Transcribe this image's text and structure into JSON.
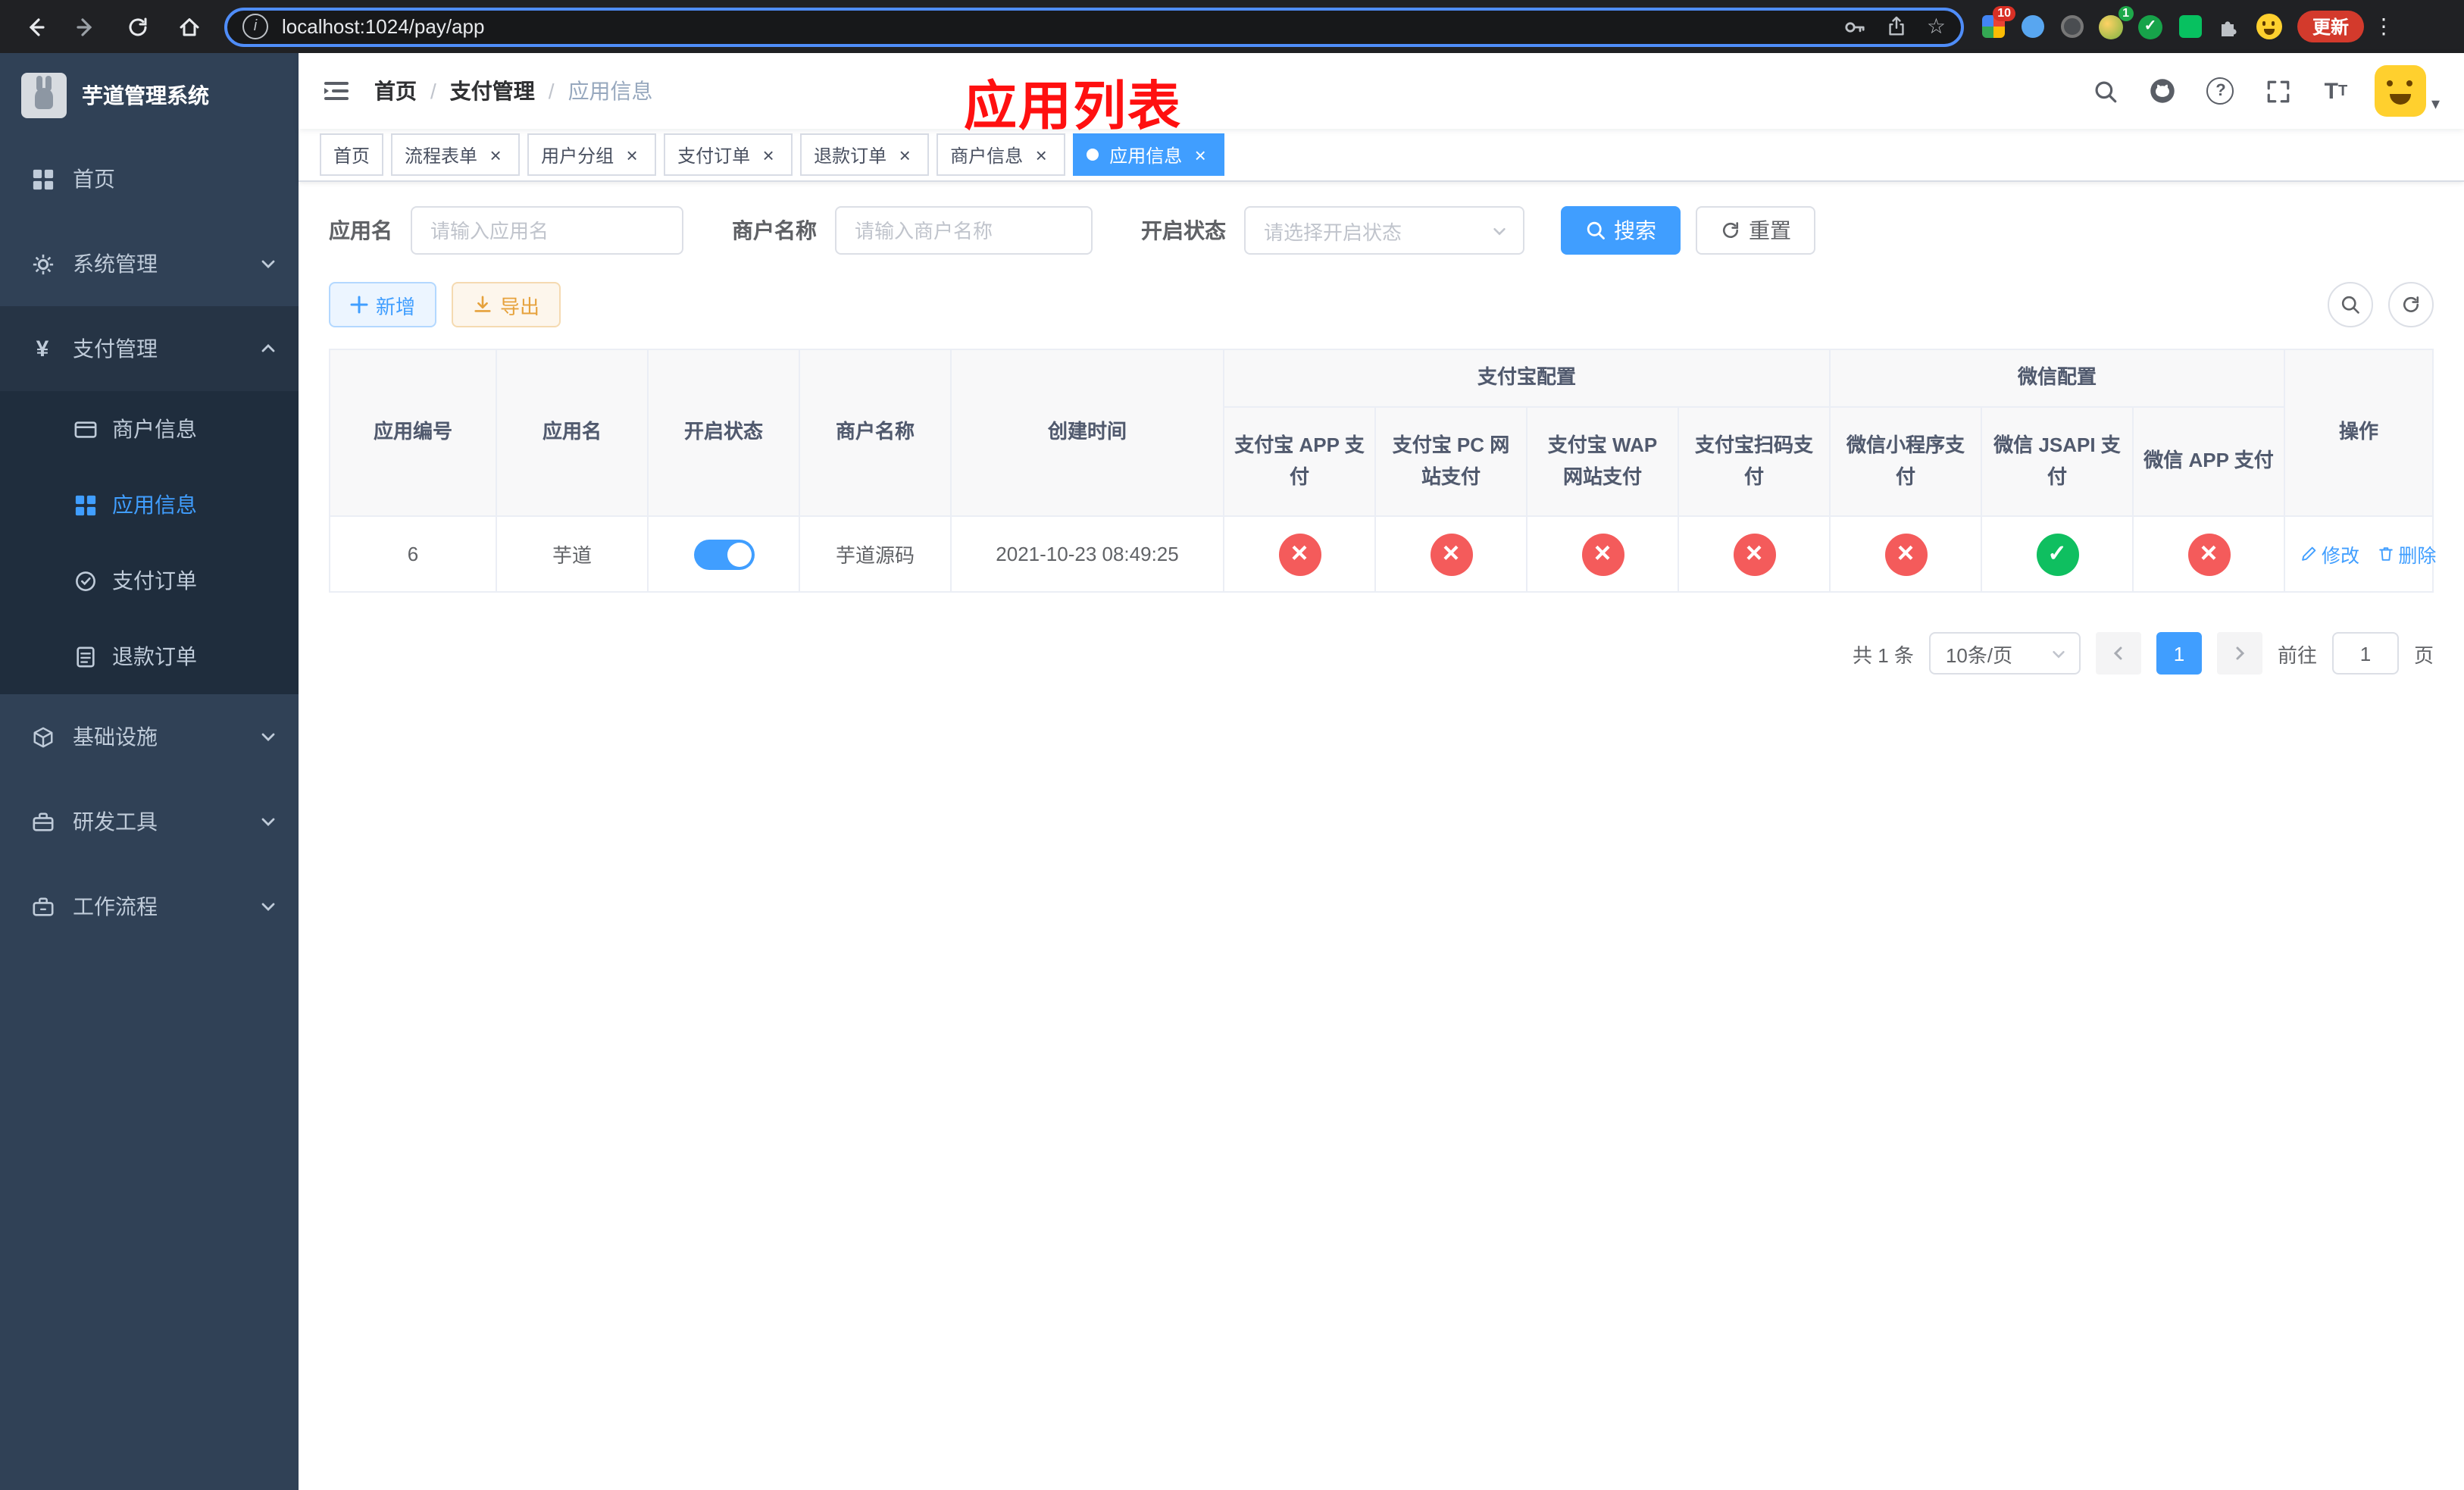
{
  "browser": {
    "url": "localhost:1024/pay/app",
    "update_label": "更新",
    "ext_badge_grid": "10",
    "ext_badge_avatar": "1"
  },
  "app": {
    "title": "芋道管理系统",
    "overlay_title": "应用列表"
  },
  "breadcrumb": {
    "items": [
      "首页",
      "支付管理",
      "应用信息"
    ]
  },
  "sidebar": {
    "home": "首页",
    "system": "系统管理",
    "payment": "支付管理",
    "merchant_info": "商户信息",
    "app_info": "应用信息",
    "pay_order": "支付订单",
    "refund_order": "退款订单",
    "infrastructure": "基础设施",
    "dev_tools": "研发工具",
    "workflow": "工作流程"
  },
  "tabs": [
    {
      "label": "首页"
    },
    {
      "label": "流程表单"
    },
    {
      "label": "用户分组"
    },
    {
      "label": "支付订单"
    },
    {
      "label": "退款订单"
    },
    {
      "label": "商户信息"
    },
    {
      "label": "应用信息"
    }
  ],
  "filters": {
    "app_name_label": "应用名",
    "app_name_placeholder": "请输入应用名",
    "merchant_label": "商户名称",
    "merchant_placeholder": "请输入商户名称",
    "status_label": "开启状态",
    "status_placeholder": "请选择开启状态",
    "search_label": "搜索",
    "reset_label": "重置"
  },
  "actions": {
    "add_label": "新增",
    "export_label": "导出"
  },
  "table": {
    "header": {
      "app_id": "应用编号",
      "app_name": "应用名",
      "status": "开启状态",
      "merchant": "商户名称",
      "created": "创建时间",
      "alipay_group": "支付宝配置",
      "wechat_group": "微信配置",
      "alipay_app": "支付宝 APP 支付",
      "alipay_pc": "支付宝 PC 网站支付",
      "alipay_wap": "支付宝 WAP 网站支付",
      "alipay_qr": "支付宝扫码支付",
      "wx_mini": "微信小程序支付",
      "wx_jsapi": "微信 JSAPI 支付",
      "wx_app": "微信 APP 支付",
      "ops": "操作"
    },
    "row": {
      "app_id": "6",
      "app_name": "芋道",
      "enabled": "true",
      "merchant": "芋道源码",
      "created": "2021-10-23 08:49:25",
      "statuses": [
        "disabled",
        "disabled",
        "disabled",
        "disabled",
        "disabled",
        "enabled",
        "disabled"
      ],
      "edit_label": "修改",
      "delete_label": "删除"
    }
  },
  "pagination": {
    "total": "共 1 条",
    "page_size": "10条/页",
    "current_page": "1",
    "goto_label": "前往",
    "goto_value": "1",
    "goto_suffix": "页"
  },
  "icons": {
    "close": "×",
    "caret": "▾",
    "sep": "/",
    "dots": "⋮",
    "star": "☆",
    "yen": "¥",
    "wechat_dot": "✓",
    "check": "✓"
  }
}
